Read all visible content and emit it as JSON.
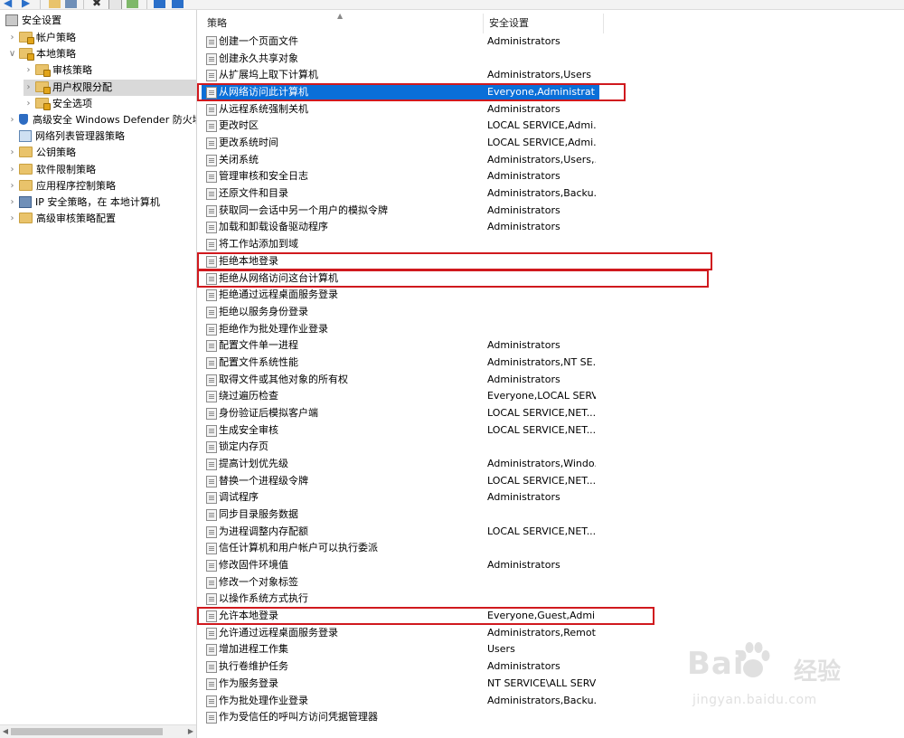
{
  "tree": {
    "root": "安全设置",
    "items": [
      {
        "label": "帐户策略",
        "level": 1,
        "expanded": false
      },
      {
        "label": "本地策略",
        "level": 1,
        "expanded": true
      },
      {
        "label": "审核策略",
        "level": 2,
        "expanded": false
      },
      {
        "label": "用户权限分配",
        "level": 2,
        "expanded": false,
        "selected": true
      },
      {
        "label": "安全选项",
        "level": 2,
        "expanded": false
      },
      {
        "label": "高级安全 Windows Defender 防火墙",
        "level": 1,
        "expanded": false
      },
      {
        "label": "网络列表管理器策略",
        "level": 1
      },
      {
        "label": "公钥策略",
        "level": 1,
        "expanded": false
      },
      {
        "label": "软件限制策略",
        "level": 1,
        "expanded": false
      },
      {
        "label": "应用程序控制策略",
        "level": 1,
        "expanded": false
      },
      {
        "label": "IP 安全策略，在 本地计算机",
        "level": 1,
        "expanded": false
      },
      {
        "label": "高级审核策略配置",
        "level": 1,
        "expanded": false
      }
    ]
  },
  "list": {
    "headers": {
      "policy": "策略",
      "setting": "安全设置"
    },
    "rows": [
      {
        "policy": "创建一个页面文件",
        "setting": "Administrators"
      },
      {
        "policy": "创建永久共享对象",
        "setting": ""
      },
      {
        "policy": "从扩展坞上取下计算机",
        "setting": "Administrators,Users"
      },
      {
        "policy": "从网络访问此计算机",
        "setting": "Everyone,Administrat...",
        "selected": true,
        "highlighted": true
      },
      {
        "policy": "从远程系统强制关机",
        "setting": "Administrators"
      },
      {
        "policy": "更改时区",
        "setting": "LOCAL SERVICE,Admi..."
      },
      {
        "policy": "更改系统时间",
        "setting": "LOCAL SERVICE,Admi..."
      },
      {
        "policy": "关闭系统",
        "setting": "Administrators,Users,..."
      },
      {
        "policy": "管理审核和安全日志",
        "setting": "Administrators"
      },
      {
        "policy": "还原文件和目录",
        "setting": "Administrators,Backu..."
      },
      {
        "policy": "获取同一会话中另一个用户的模拟令牌",
        "setting": "Administrators"
      },
      {
        "policy": "加载和卸载设备驱动程序",
        "setting": "Administrators"
      },
      {
        "policy": "将工作站添加到域",
        "setting": ""
      },
      {
        "policy": "拒绝本地登录",
        "setting": "",
        "highlighted": true
      },
      {
        "policy": "拒绝从网络访问这台计算机",
        "setting": "",
        "highlighted": true
      },
      {
        "policy": "拒绝通过远程桌面服务登录",
        "setting": ""
      },
      {
        "policy": "拒绝以服务身份登录",
        "setting": ""
      },
      {
        "policy": "拒绝作为批处理作业登录",
        "setting": ""
      },
      {
        "policy": "配置文件单一进程",
        "setting": "Administrators"
      },
      {
        "policy": "配置文件系统性能",
        "setting": "Administrators,NT SE..."
      },
      {
        "policy": "取得文件或其他对象的所有权",
        "setting": "Administrators"
      },
      {
        "policy": "绕过遍历检查",
        "setting": "Everyone,LOCAL SERV..."
      },
      {
        "policy": "身份验证后模拟客户端",
        "setting": "LOCAL SERVICE,NET..."
      },
      {
        "policy": "生成安全审核",
        "setting": "LOCAL SERVICE,NET..."
      },
      {
        "policy": "锁定内存页",
        "setting": ""
      },
      {
        "policy": "提高计划优先级",
        "setting": "Administrators,Windo..."
      },
      {
        "policy": "替换一个进程级令牌",
        "setting": "LOCAL SERVICE,NET..."
      },
      {
        "policy": "调试程序",
        "setting": "Administrators"
      },
      {
        "policy": "同步目录服务数据",
        "setting": ""
      },
      {
        "policy": "为进程调整内存配额",
        "setting": "LOCAL SERVICE,NET..."
      },
      {
        "policy": "信任计算机和用户帐户可以执行委派",
        "setting": ""
      },
      {
        "policy": "修改固件环境值",
        "setting": "Administrators"
      },
      {
        "policy": "修改一个对象标签",
        "setting": ""
      },
      {
        "policy": "以操作系统方式执行",
        "setting": ""
      },
      {
        "policy": "允许本地登录",
        "setting": "Everyone,Guest,Admin...",
        "highlighted": true
      },
      {
        "policy": "允许通过远程桌面服务登录",
        "setting": "Administrators,Remot..."
      },
      {
        "policy": "增加进程工作集",
        "setting": "Users"
      },
      {
        "policy": "执行卷维护任务",
        "setting": "Administrators"
      },
      {
        "policy": "作为服务登录",
        "setting": "NT SERVICE\\ALL SERV..."
      },
      {
        "policy": "作为批处理作业登录",
        "setting": "Administrators,Backu..."
      },
      {
        "policy": "作为受信任的呼叫方访问凭据管理器",
        "setting": ""
      }
    ]
  },
  "watermark": {
    "brand_a": "Bai",
    "brand_b": "经验",
    "url": "jingyan.baidu.com"
  },
  "colors": {
    "selection": "#0a6fd8",
    "highlight_box": "#d0191e"
  }
}
